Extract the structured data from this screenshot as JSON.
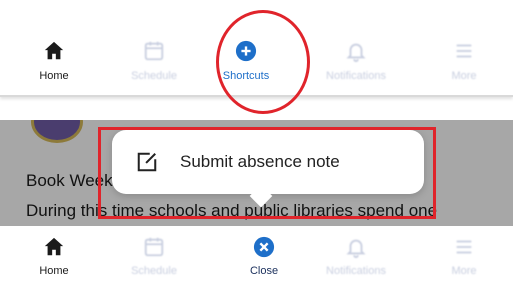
{
  "top_nav": {
    "tabs": [
      {
        "label": "Home",
        "icon": "home-icon"
      },
      {
        "label": "Schedule",
        "icon": "calendar-icon"
      },
      {
        "label": "Shortcuts",
        "icon": "plus-circle-icon"
      },
      {
        "label": "Notifications",
        "icon": "bell-icon"
      },
      {
        "label": "More",
        "icon": "menu-icon"
      }
    ],
    "active": "Shortcuts"
  },
  "content": {
    "headline": "Book Week",
    "body": "During this time schools and public libraries spend one"
  },
  "shortcut_menu": {
    "items": [
      {
        "label": "Submit absence note",
        "icon": "edit-note-icon"
      }
    ]
  },
  "bottom_nav": {
    "tabs": [
      {
        "label": "Home",
        "icon": "home-icon"
      },
      {
        "label": "Schedule",
        "icon": "calendar-icon"
      },
      {
        "label": "Close",
        "icon": "close-circle-icon"
      },
      {
        "label": "Notifications",
        "icon": "bell-icon"
      },
      {
        "label": "More",
        "icon": "menu-icon"
      }
    ]
  },
  "colors": {
    "accent": "#1e6fc9",
    "dark_accent": "#1a2f5c",
    "highlight_red": "#e0242b",
    "inactive": "#c9cfe0",
    "overlay": "#a7a7a7"
  }
}
